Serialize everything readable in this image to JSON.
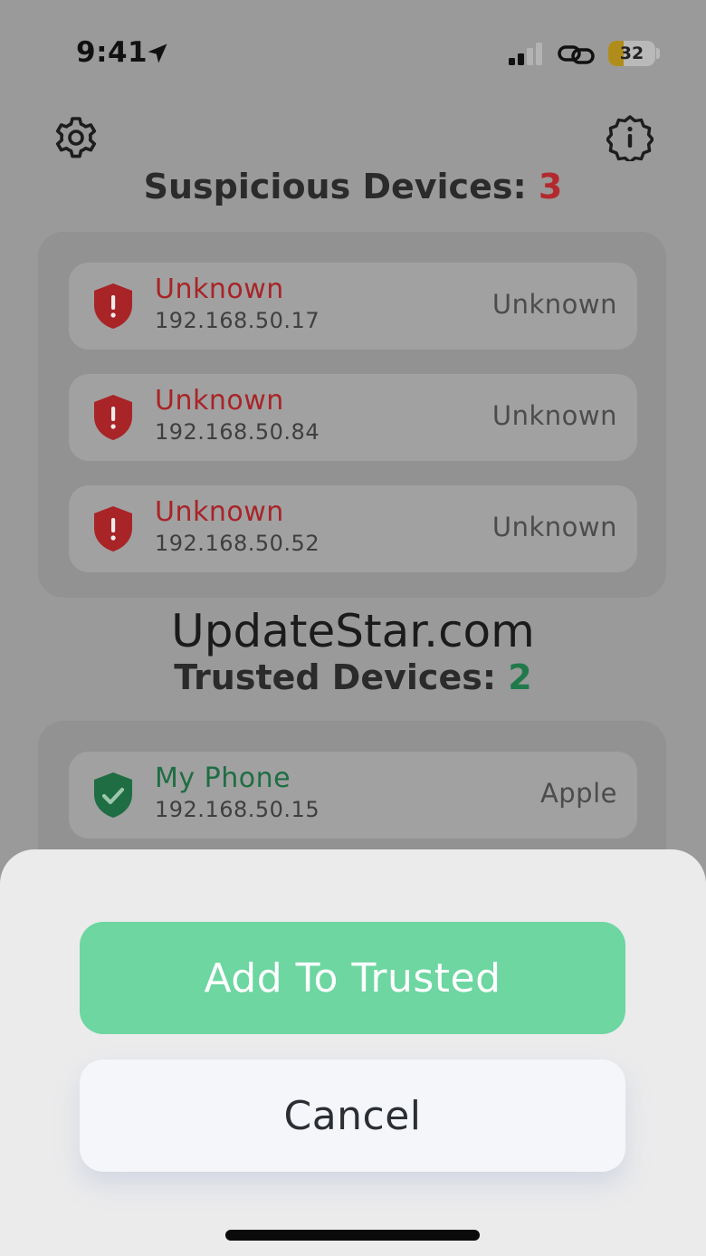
{
  "status": {
    "time": "9:41",
    "battery": "32",
    "battery_level": 0.32
  },
  "header": {
    "settings_icon": "gear-icon",
    "info_icon": "info-badge-icon"
  },
  "suspicious": {
    "label": "Suspicious Devices: ",
    "count": "3",
    "color": "#b22a2e",
    "devices": [
      {
        "name": "Unknown",
        "ip": "192.168.50.17",
        "vendor": "Unknown",
        "icon": "shield-alert-icon"
      },
      {
        "name": "Unknown",
        "ip": "192.168.50.84",
        "vendor": "Unknown",
        "icon": "shield-alert-icon"
      },
      {
        "name": "Unknown",
        "ip": "192.168.50.52",
        "vendor": "Unknown",
        "icon": "shield-alert-icon"
      }
    ]
  },
  "watermark": "UpdateStar.com",
  "trusted": {
    "label": "Trusted Devices: ",
    "count": "2",
    "color": "#1f7a4a",
    "devices": [
      {
        "name": "My Phone",
        "ip": "192.168.50.15",
        "vendor": "Apple",
        "icon": "shield-check-icon"
      }
    ]
  },
  "sheet": {
    "primary_label": "Add To Trusted",
    "primary_color": "#6dd6a1",
    "cancel_label": "Cancel"
  }
}
